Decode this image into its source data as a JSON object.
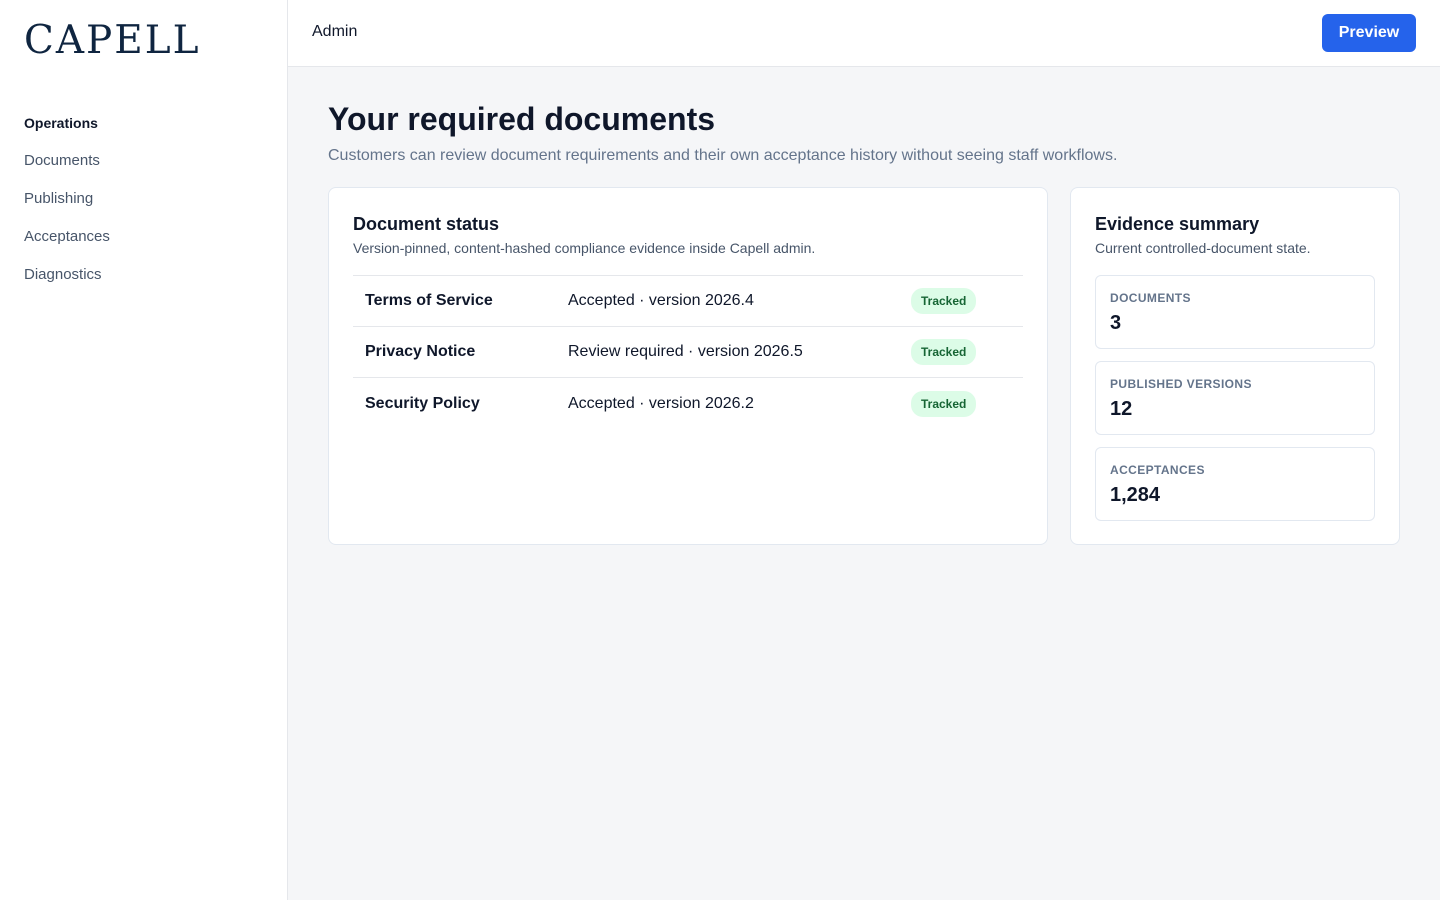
{
  "brand": {
    "logo": "CAPELL"
  },
  "sidebar": {
    "section": "Operations",
    "items": [
      {
        "label": "Documents"
      },
      {
        "label": "Publishing"
      },
      {
        "label": "Acceptances"
      },
      {
        "label": "Diagnostics"
      }
    ]
  },
  "topbar": {
    "title": "Admin",
    "preview_label": "Preview",
    "accent": "#2563eb"
  },
  "page": {
    "title": "Your required documents",
    "subtitle": "Customers can review document requirements and their own acceptance history without seeing staff workflows."
  },
  "document_status": {
    "title": "Document status",
    "subtitle": "Version-pinned, content-hashed compliance evidence inside Capell admin.",
    "rows": [
      {
        "name": "Terms of Service",
        "state": "Accepted · version 2026.4",
        "badge": "Tracked"
      },
      {
        "name": "Privacy Notice",
        "state": "Review required · version 2026.5",
        "badge": "Tracked"
      },
      {
        "name": "Security Policy",
        "state": "Accepted · version 2026.2",
        "badge": "Tracked"
      }
    ]
  },
  "evidence": {
    "title": "Evidence summary",
    "subtitle": "Current controlled-document state.",
    "stats": [
      {
        "label": "DOCUMENTS",
        "value": "3"
      },
      {
        "label": "PUBLISHED VERSIONS",
        "value": "12"
      },
      {
        "label": "ACCEPTANCES",
        "value": "1,284"
      }
    ]
  }
}
